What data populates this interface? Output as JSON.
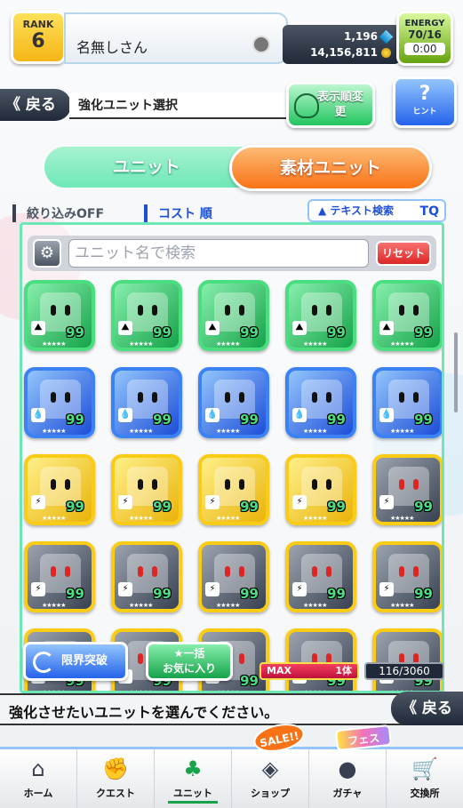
{
  "header": {
    "rank_label": "RANK",
    "rank_value": "6",
    "player_name": "名無しさん",
    "gems": "1,196",
    "coins": "14,156,811",
    "energy_label": "ENERGY",
    "energy_value": "70/16",
    "energy_timer": "0:00"
  },
  "title_bar": {
    "back_label": "《 戻る",
    "page_title": "強化ユニット選択",
    "sort_order_label": "表示順変更",
    "hint_label": "ヒント"
  },
  "tabs": [
    {
      "label": "ユニット",
      "active": false
    },
    {
      "label": "素材ユニット",
      "active": true
    }
  ],
  "filters": {
    "filter_label": "絞り込みOFF",
    "sort_label": "コスト 順",
    "text_search_label": "▲ テキスト検索",
    "tq_icon": "TQ"
  },
  "search": {
    "placeholder": "ユニット名で検索",
    "reset_label": "リセット"
  },
  "units": [
    {
      "color": "green",
      "attr": "⛰",
      "level": "99",
      "stars": "★★★★★"
    },
    {
      "color": "green",
      "attr": "⛰",
      "level": "99",
      "stars": "★★★★★"
    },
    {
      "color": "green",
      "attr": "⛰",
      "level": "99",
      "stars": "★★★★★"
    },
    {
      "color": "green",
      "attr": "⛰",
      "level": "99",
      "stars": "★★★★★"
    },
    {
      "color": "green",
      "attr": "⛰",
      "level": "99",
      "stars": "★★★★★"
    },
    {
      "color": "blue",
      "attr": "💧",
      "level": "99",
      "stars": "★★★★★"
    },
    {
      "color": "blue",
      "attr": "💧",
      "level": "99",
      "stars": "★★★★★"
    },
    {
      "color": "blue",
      "attr": "💧",
      "level": "99",
      "stars": "★★★★★"
    },
    {
      "color": "blue",
      "attr": "💧",
      "level": "99",
      "stars": "★★★★★"
    },
    {
      "color": "blue",
      "attr": "💧",
      "level": "99",
      "stars": "★★★★★"
    },
    {
      "color": "yellow",
      "attr": "⚡",
      "level": "99",
      "stars": "★★★★★"
    },
    {
      "color": "yellow",
      "attr": "⚡",
      "level": "99",
      "stars": "★★★★★"
    },
    {
      "color": "yellow",
      "attr": "⚡",
      "level": "99",
      "stars": "★★★★★"
    },
    {
      "color": "yellow",
      "attr": "⚡",
      "level": "99",
      "stars": "★★★★★"
    },
    {
      "color": "dark",
      "attr": "⚡",
      "level": "99",
      "stars": "★★★★★"
    },
    {
      "color": "dark",
      "attr": "⚡",
      "level": "99",
      "stars": "★★★★★"
    },
    {
      "color": "dark",
      "attr": "⚡",
      "level": "99",
      "stars": "★★★★★"
    },
    {
      "color": "dark",
      "attr": "⚡",
      "level": "99",
      "stars": "★★★★★"
    },
    {
      "color": "dark",
      "attr": "⚡",
      "level": "99",
      "stars": "★★★★★"
    },
    {
      "color": "dark",
      "attr": "⚡",
      "level": "99",
      "stars": "★★★★★"
    },
    {
      "color": "dark",
      "attr": "⚡",
      "level": "99",
      "stars": "★★★★★"
    },
    {
      "color": "dark",
      "attr": "⚡",
      "level": "99",
      "stars": "★★★★★"
    },
    {
      "color": "dark",
      "attr": "⚡",
      "level": "99",
      "stars": "★★★★★"
    },
    {
      "color": "dark",
      "attr": "⚡",
      "level": "99",
      "stars": "★★★★★"
    },
    {
      "color": "dark",
      "attr": "⚡",
      "level": "99",
      "stars": "★★★★★"
    }
  ],
  "actions": {
    "limit_break_label": "限界突破",
    "fav_line1": "★一括",
    "fav_line2": "お気に入り",
    "max_label": "MAX",
    "max_count": "1体",
    "unit_count": "116/3060"
  },
  "message": {
    "text": "強化させたいユニットを選んでください。",
    "back_label": "《 戻る"
  },
  "nav": [
    {
      "label": "ホーム",
      "icon": "⌂",
      "active": false
    },
    {
      "label": "クエスト",
      "icon": "✊",
      "active": false
    },
    {
      "label": "ユニット",
      "icon": "♣",
      "active": true
    },
    {
      "label": "ショップ",
      "icon": "◈",
      "active": false
    },
    {
      "label": "ガチャ",
      "icon": "●",
      "active": false
    },
    {
      "label": "交換所",
      "icon": "🛒",
      "active": false
    }
  ],
  "badges": {
    "sale": "SALE!!",
    "fes": "フェス"
  }
}
